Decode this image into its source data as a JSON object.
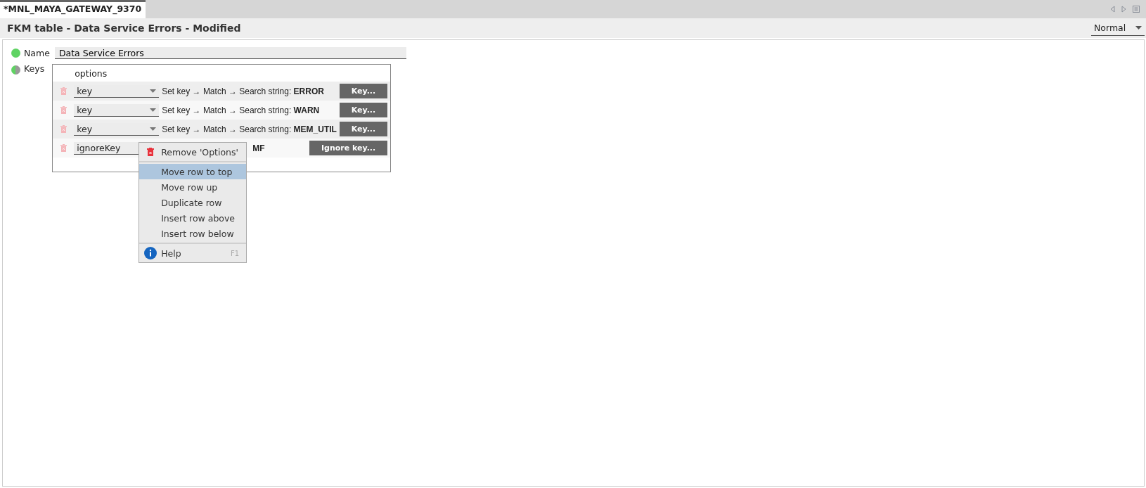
{
  "tabs": [
    {
      "label": "*MNL_MAYA_GATEWAY_9370",
      "selected": true
    }
  ],
  "header": {
    "title": "FKM table - Data Service Errors - Modified",
    "mode": "Normal"
  },
  "name_field": {
    "label": "Name",
    "value": "Data Service Errors",
    "color": "#5fd363"
  },
  "keys": {
    "label": "Keys",
    "color": "#5fd363",
    "column": "options",
    "rows": [
      {
        "key": "key",
        "description": "Set key → Match → Search string: **ERROR**",
        "button": "Key..."
      },
      {
        "key": "key",
        "description": "Set key → Match → Search string: **WARN**",
        "button": "Key..."
      },
      {
        "key": "key",
        "description": "Set key → Match → Search string: **MEM_UTIL**",
        "button": "Key..."
      },
      {
        "key": "ignoreKey",
        "description": "**MF**",
        "button": "Ignore key...",
        "menu": {
          "items": [
            {
              "kind": "remove",
              "label": "Remove 'Options'",
              "selected": false
            },
            {
              "kind": "plain",
              "label": "Move row to top",
              "selected": true
            },
            {
              "kind": "plain",
              "label": "Move row up",
              "selected": false
            },
            {
              "kind": "plain",
              "label": "Duplicate row",
              "selected": false
            },
            {
              "kind": "plain",
              "label": "Insert row above",
              "selected": false
            },
            {
              "kind": "plain",
              "label": "Insert row below",
              "selected": false
            },
            {
              "kind": "help",
              "label": "Help",
              "shortcut": "F1",
              "selected": false
            }
          ]
        }
      }
    ]
  }
}
